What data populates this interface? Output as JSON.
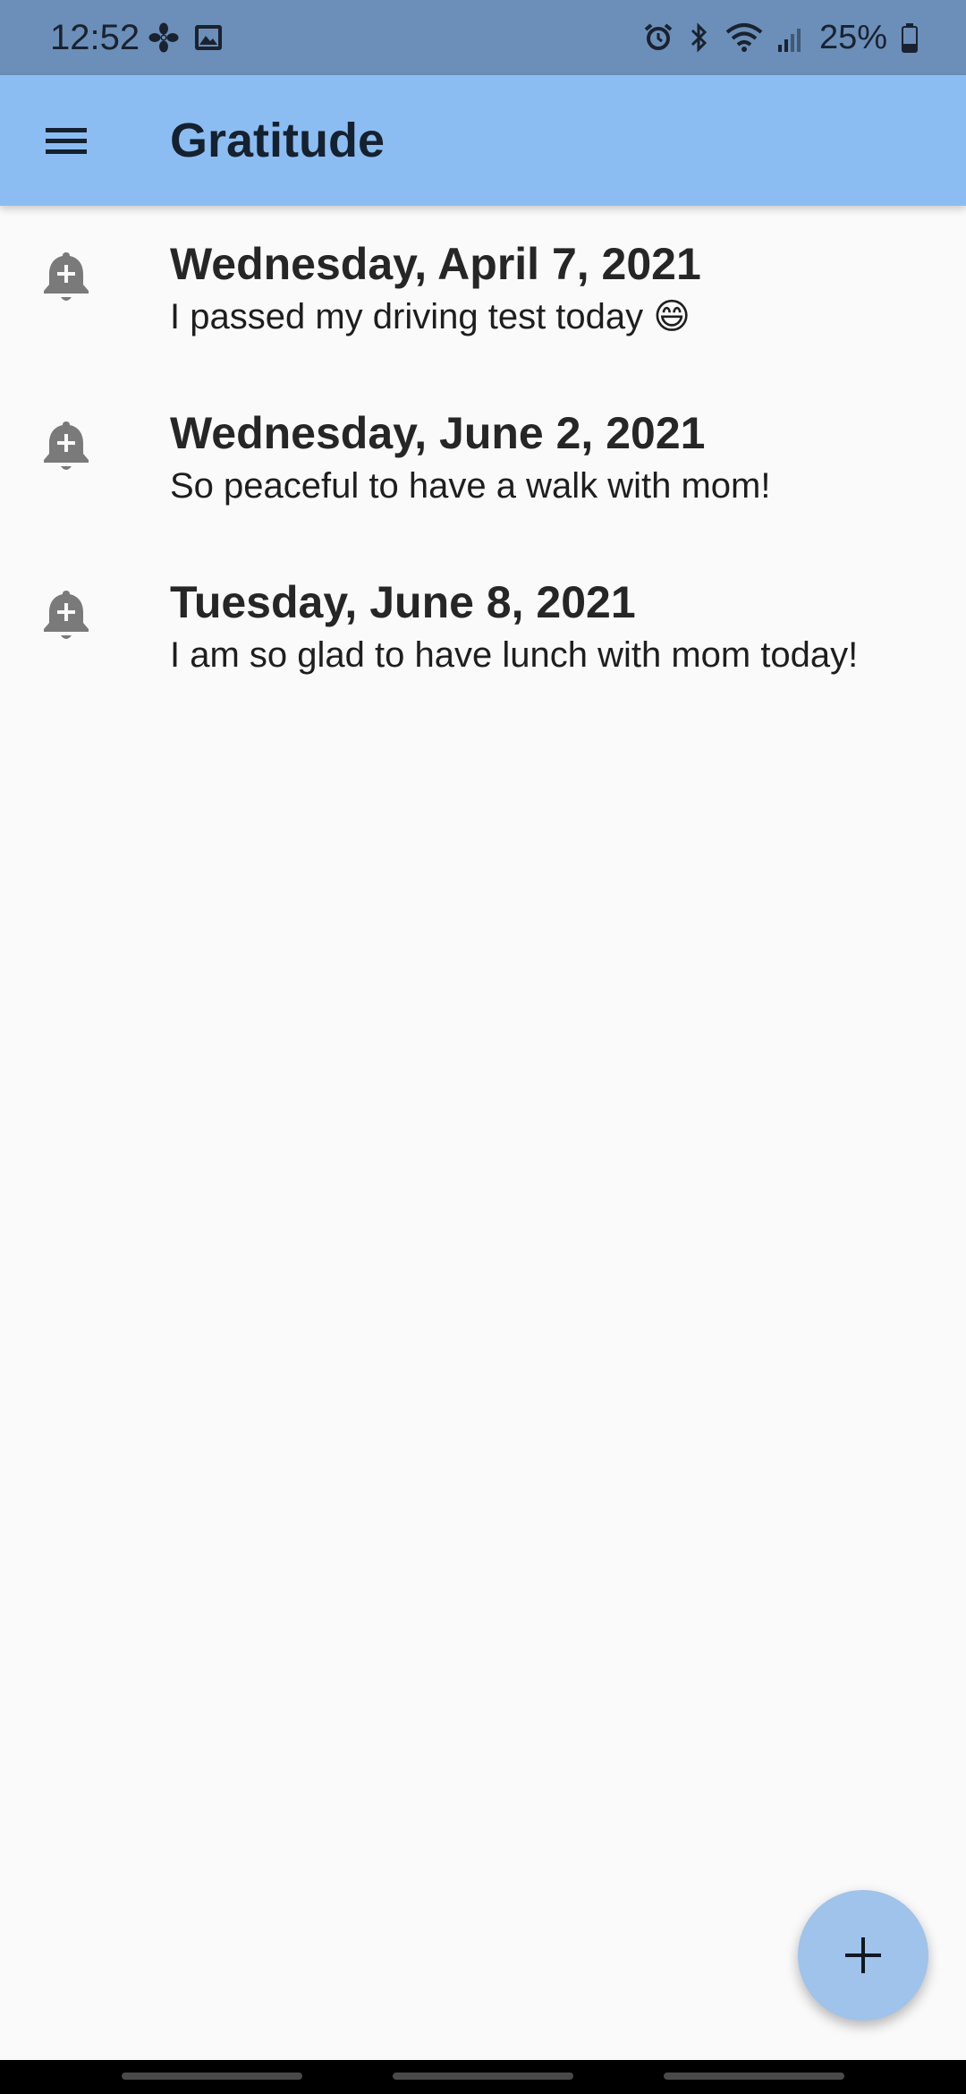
{
  "status_bar": {
    "time": "12:52",
    "left_icons": [
      "fan-icon",
      "image-icon"
    ],
    "right_icons": [
      "alarm-icon",
      "bluetooth-icon",
      "wifi-icon",
      "signal-icon",
      "battery-icon"
    ],
    "battery_percent": "25%"
  },
  "app_bar": {
    "title": "Gratitude",
    "menu_icon": "hamburger-menu-icon",
    "background": "#8cbdf2"
  },
  "entries": [
    {
      "date": "Wednesday, April 7, 2021",
      "text": "I passed my driving test today 😄",
      "icon": "bell-plus-icon"
    },
    {
      "date": "Wednesday, June 2, 2021",
      "text": "So peaceful to have a walk with mom!",
      "icon": "bell-plus-icon"
    },
    {
      "date": "Tuesday, June 8, 2021",
      "text": "I am so glad to have lunch with mom today!",
      "icon": "bell-plus-icon"
    }
  ],
  "fab": {
    "icon": "plus-icon",
    "background": "#9fc3ea"
  },
  "colors": {
    "status_bar": "#6b8fb8",
    "page_background": "#fafafa",
    "nav_bar": "#000000"
  }
}
